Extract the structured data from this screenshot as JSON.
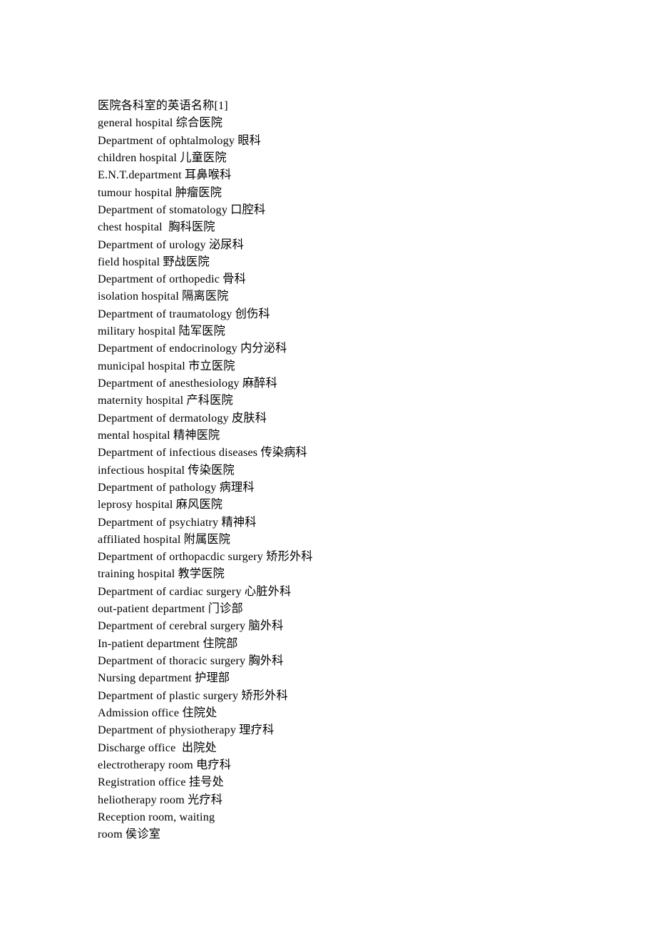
{
  "document": {
    "title": "医院各科室的英语名称[1]",
    "background_color": "#ffffff",
    "text_color": "#000000",
    "lines": [
      {
        "text": "医院各科室的英语名称[1]"
      },
      {
        "text": "general hospital 综合医院"
      },
      {
        "text": "Department of ophtalmology 眼科"
      },
      {
        "text": "children hospital 儿童医院"
      },
      {
        "text": "E.N.T.department 耳鼻喉科"
      },
      {
        "text": "tumour hospital 肿瘤医院"
      },
      {
        "text": "Department of stomatology 口腔科"
      },
      {
        "text": "chest hospital  胸科医院"
      },
      {
        "text": "Department of urology 泌尿科"
      },
      {
        "text": "field hospital 野战医院"
      },
      {
        "text": "Department of orthopedic 骨科"
      },
      {
        "text": "isolation hospital 隔离医院"
      },
      {
        "text": "Department of traumatology 创伤科"
      },
      {
        "text": "military hospital 陆军医院"
      },
      {
        "text": "Department of endocrinology 内分泌科"
      },
      {
        "text": "municipal hospital 市立医院"
      },
      {
        "text": "Department of anesthesiology 麻醉科"
      },
      {
        "text": "maternity hospital 产科医院"
      },
      {
        "text": "Department of dermatology 皮肤科"
      },
      {
        "text": "mental hospital 精神医院"
      },
      {
        "text": "Department of infectious diseases 传染病科"
      },
      {
        "text": "infectious hospital 传染医院"
      },
      {
        "text": "Department of pathology 病理科"
      },
      {
        "text": "leprosy hospital 麻风医院"
      },
      {
        "text": "Department of psychiatry 精神科"
      },
      {
        "text": "affiliated hospital 附属医院"
      },
      {
        "text": "Department of orthopacdic surgery 矫形外科"
      },
      {
        "text": "training hospital 教学医院"
      },
      {
        "text": "Department of cardiac surgery 心脏外科"
      },
      {
        "text": "out-patient department 门诊部"
      },
      {
        "text": "Department of cerebral surgery 脑外科"
      },
      {
        "text": "In-patient department 住院部"
      },
      {
        "text": "Department of thoracic surgery 胸外科"
      },
      {
        "text": "Nursing department 护理部"
      },
      {
        "text": "Department of plastic surgery 矫形外科"
      },
      {
        "text": "Admission office 住院处"
      },
      {
        "text": "Department of physiotherapy 理疗科"
      },
      {
        "text": "Discharge office  出院处"
      },
      {
        "text": "electrotherapy room 电疗科"
      },
      {
        "text": "Registration office 挂号处"
      },
      {
        "text": "heliotherapy room 光疗科"
      },
      {
        "text": "Reception room, waiting"
      },
      {
        "text": "room 侯诊室"
      }
    ]
  }
}
